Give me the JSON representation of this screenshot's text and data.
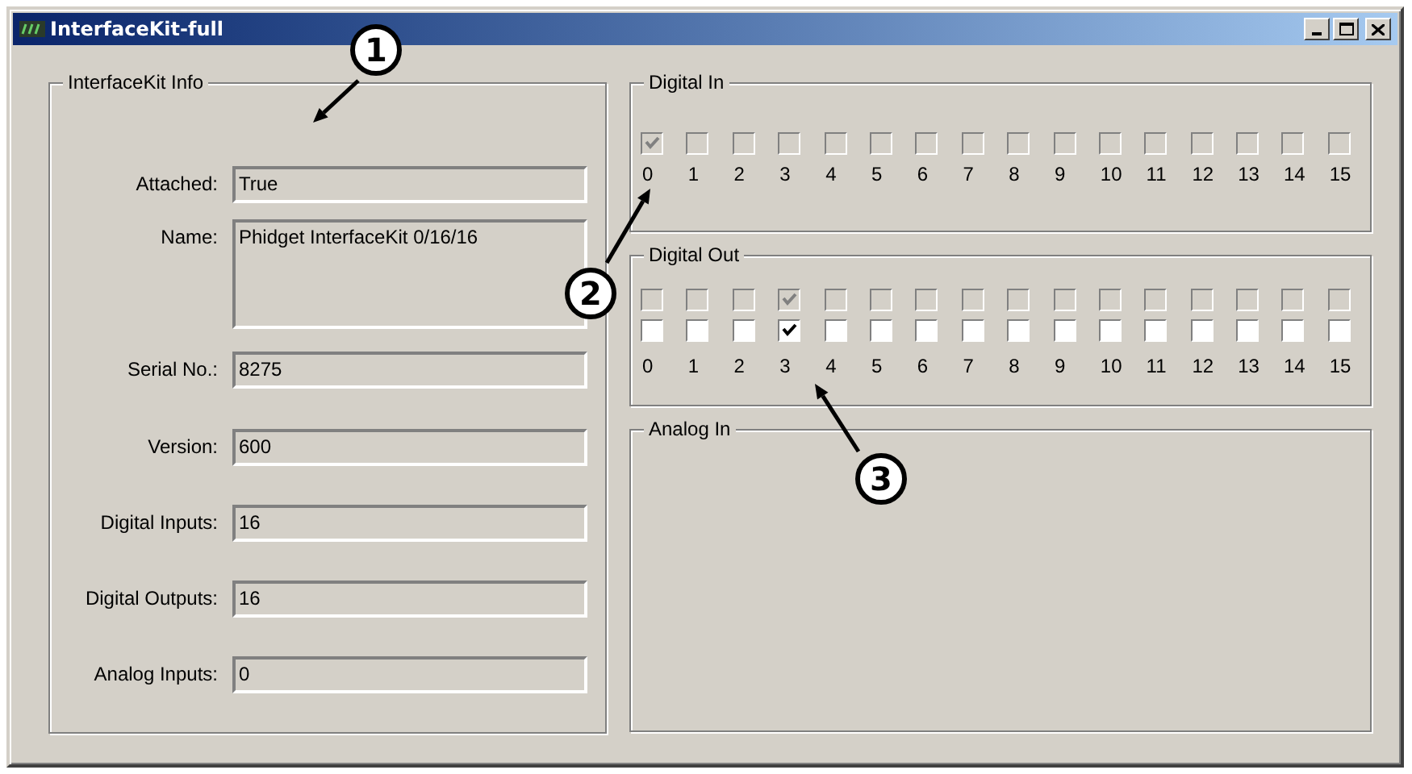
{
  "window": {
    "title": "InterfaceKit-full"
  },
  "info": {
    "title": "InterfaceKit Info",
    "fields": [
      {
        "label": "Attached:",
        "value": "True",
        "kind": "line"
      },
      {
        "label": "Name:",
        "value": "Phidget InterfaceKit 0/16/16",
        "kind": "multiline"
      },
      {
        "label": "Serial No.:",
        "value": "8275",
        "kind": "line"
      },
      {
        "label": "Version:",
        "value": "600",
        "kind": "line"
      },
      {
        "label": "Digital Inputs:",
        "value": "16",
        "kind": "line"
      },
      {
        "label": "Digital Outputs:",
        "value": "16",
        "kind": "line"
      },
      {
        "label": "Analog Inputs:",
        "value": "0",
        "kind": "line"
      }
    ]
  },
  "digital_in": {
    "title": "Digital In",
    "channels": [
      {
        "label": "0",
        "checked": true
      },
      {
        "label": "1",
        "checked": false
      },
      {
        "label": "2",
        "checked": false
      },
      {
        "label": "3",
        "checked": false
      },
      {
        "label": "4",
        "checked": false
      },
      {
        "label": "5",
        "checked": false
      },
      {
        "label": "6",
        "checked": false
      },
      {
        "label": "7",
        "checked": false
      },
      {
        "label": "8",
        "checked": false
      },
      {
        "label": "9",
        "checked": false
      },
      {
        "label": "10",
        "checked": false
      },
      {
        "label": "11",
        "checked": false
      },
      {
        "label": "12",
        "checked": false
      },
      {
        "label": "13",
        "checked": false
      },
      {
        "label": "14",
        "checked": false
      },
      {
        "label": "15",
        "checked": false
      }
    ]
  },
  "digital_out": {
    "title": "Digital Out",
    "channels": [
      {
        "label": "0",
        "state_checked": false,
        "checked": false
      },
      {
        "label": "1",
        "state_checked": false,
        "checked": false
      },
      {
        "label": "2",
        "state_checked": false,
        "checked": false
      },
      {
        "label": "3",
        "state_checked": true,
        "checked": true
      },
      {
        "label": "4",
        "state_checked": false,
        "checked": false
      },
      {
        "label": "5",
        "state_checked": false,
        "checked": false
      },
      {
        "label": "6",
        "state_checked": false,
        "checked": false
      },
      {
        "label": "7",
        "state_checked": false,
        "checked": false
      },
      {
        "label": "8",
        "state_checked": false,
        "checked": false
      },
      {
        "label": "9",
        "state_checked": false,
        "checked": false
      },
      {
        "label": "10",
        "state_checked": false,
        "checked": false
      },
      {
        "label": "11",
        "state_checked": false,
        "checked": false
      },
      {
        "label": "12",
        "state_checked": false,
        "checked": false
      },
      {
        "label": "13",
        "state_checked": false,
        "checked": false
      },
      {
        "label": "14",
        "state_checked": false,
        "checked": false
      },
      {
        "label": "15",
        "state_checked": false,
        "checked": false
      }
    ]
  },
  "analog_in": {
    "title": "Analog In"
  },
  "callouts": [
    {
      "number": "1"
    },
    {
      "number": "2"
    },
    {
      "number": "3"
    }
  ]
}
